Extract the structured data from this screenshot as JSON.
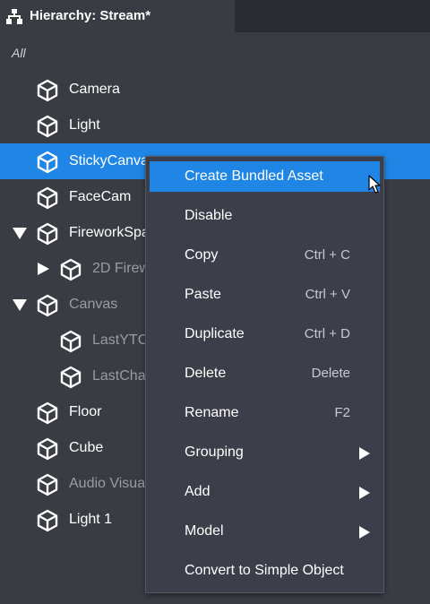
{
  "header": {
    "title": "Hierarchy: Stream*",
    "icon": "hierarchy-icon"
  },
  "filter": {
    "text": "All"
  },
  "tree": [
    {
      "label": "Camera"
    },
    {
      "label": "Light"
    },
    {
      "label": "StickyCanva",
      "selected": true
    },
    {
      "label": "FaceCam"
    },
    {
      "label": "FireworkSpa",
      "expanded": true
    },
    {
      "label": "2D Firew",
      "collapsed": true,
      "dim": true
    },
    {
      "label": "Canvas",
      "expanded": true,
      "dim": true
    },
    {
      "label": "LastYTC",
      "dim": true
    },
    {
      "label": "LastCha",
      "dim": true
    },
    {
      "label": "Floor"
    },
    {
      "label": "Cube"
    },
    {
      "label": "Audio Visua",
      "dim": true
    },
    {
      "label": "Light 1"
    }
  ],
  "context_menu": {
    "items": [
      {
        "label": "Create Bundled Asset",
        "shortcut": "",
        "highlighted": true
      },
      {
        "label": "Disable",
        "shortcut": ""
      },
      {
        "label": "Copy",
        "shortcut": "Ctrl + C"
      },
      {
        "label": "Paste",
        "shortcut": "Ctrl + V"
      },
      {
        "label": "Duplicate",
        "shortcut": "Ctrl + D"
      },
      {
        "label": "Delete",
        "shortcut": "Delete"
      },
      {
        "label": "Rename",
        "shortcut": "F2"
      },
      {
        "label": "Grouping",
        "shortcut": "",
        "submenu": true
      },
      {
        "label": "Add",
        "shortcut": "",
        "submenu": true
      },
      {
        "label": "Model",
        "shortcut": "",
        "submenu": true
      },
      {
        "label": "Convert to Simple Object",
        "shortcut": ""
      }
    ]
  },
  "colors": {
    "selection": "#1f86e6",
    "panel": "#3a3c44",
    "menu": "#3c3f4a"
  }
}
